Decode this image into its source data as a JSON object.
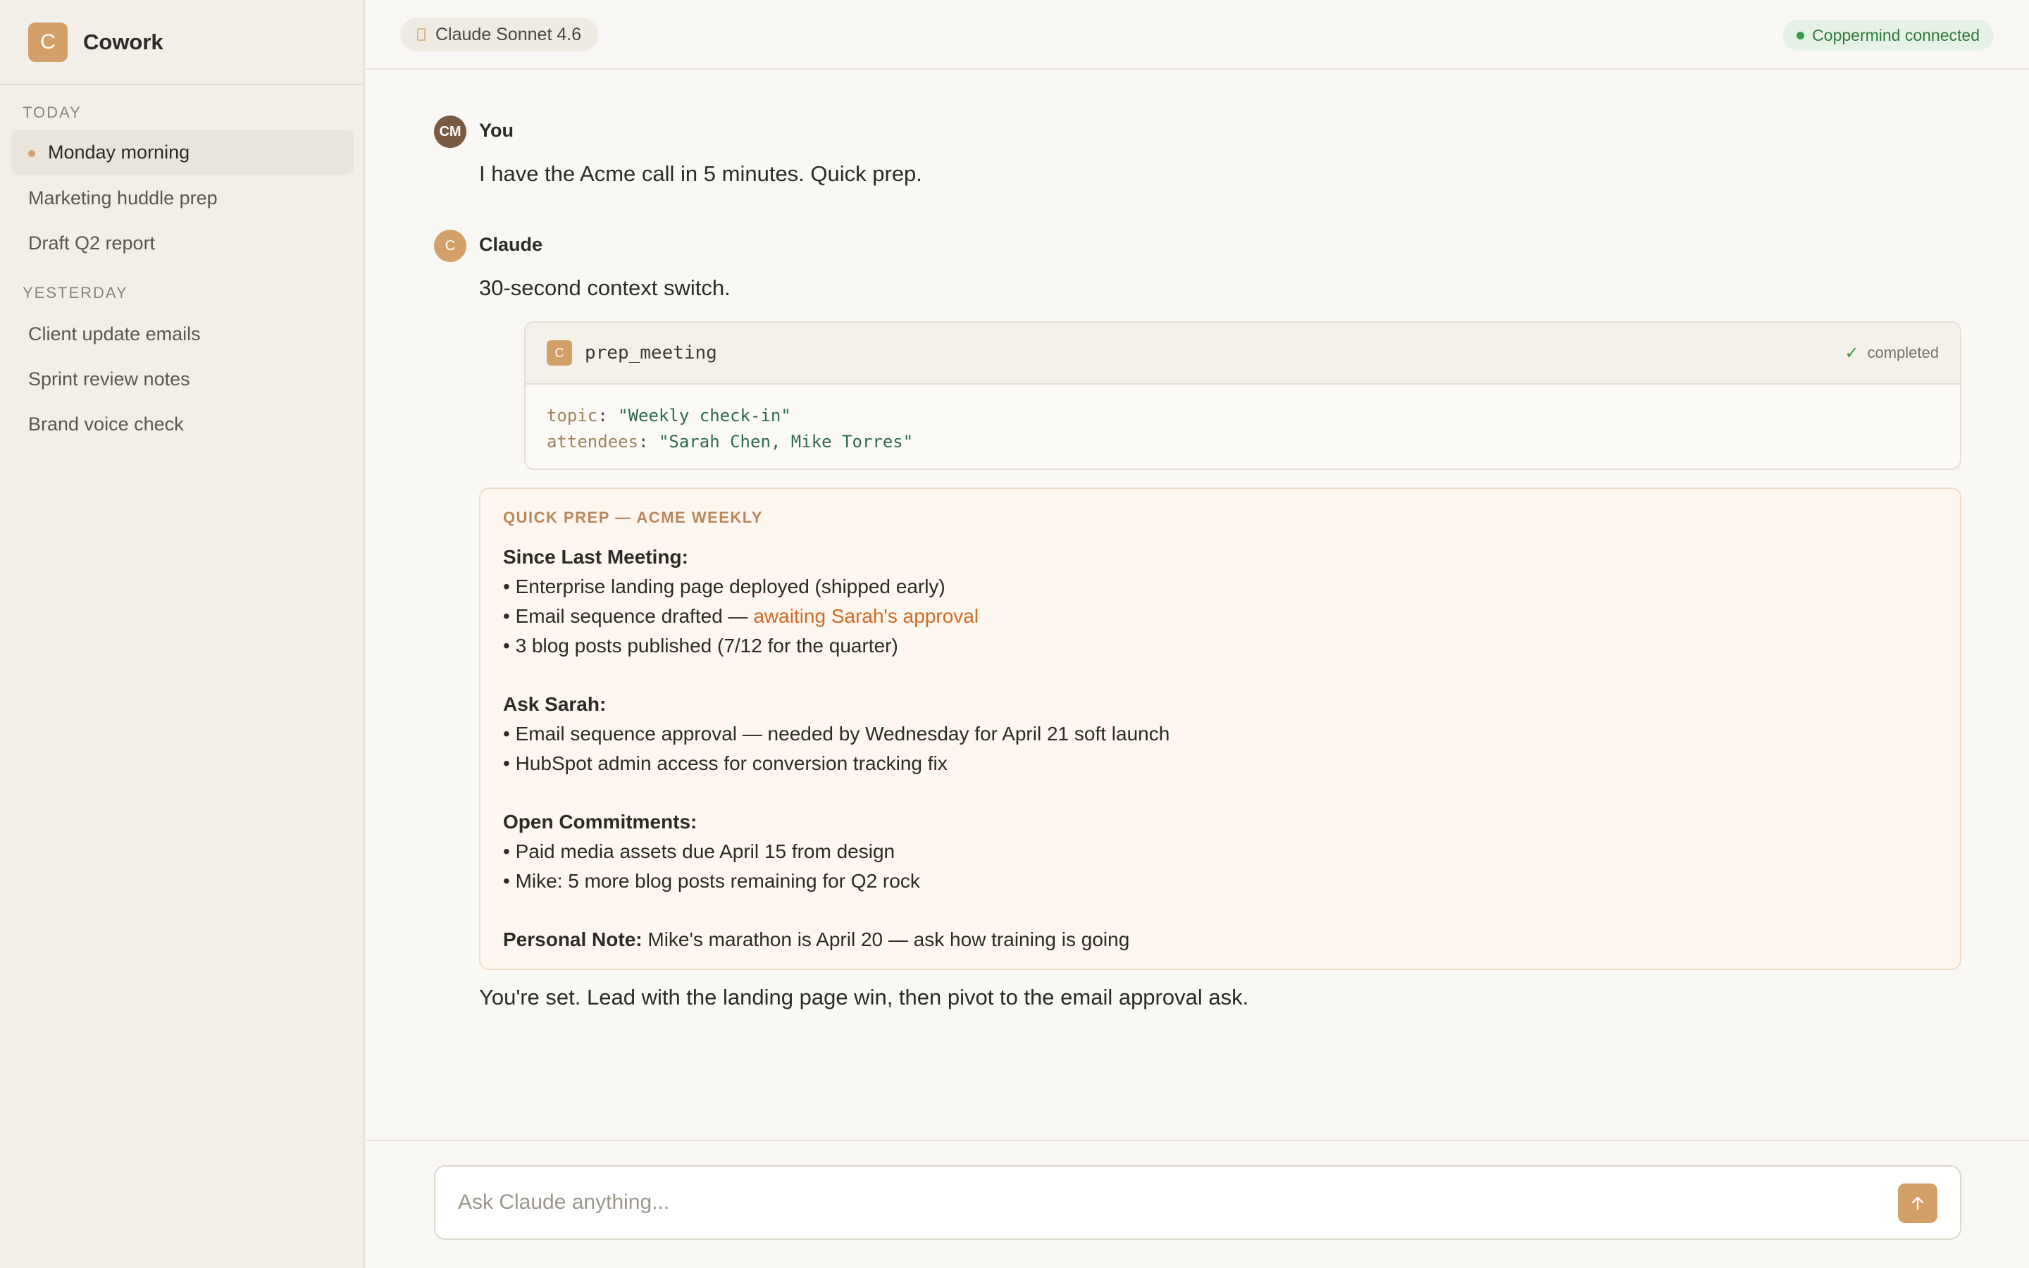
{
  "app": {
    "logo_letter": "C",
    "name": "Cowork"
  },
  "sidebar": {
    "today_label": "TODAY",
    "yesterday_label": "YESTERDAY",
    "today_items": [
      {
        "label": "Monday morning",
        "active": true
      },
      {
        "label": "Marketing huddle prep"
      },
      {
        "label": "Draft Q2 report"
      }
    ],
    "yesterday_items": [
      {
        "label": "Client update emails"
      },
      {
        "label": "Sprint review notes"
      },
      {
        "label": "Brand voice check"
      }
    ]
  },
  "topbar": {
    "model": "Claude Sonnet 4.6",
    "status": "Coppermind connected"
  },
  "conversation": {
    "user": {
      "initials": "CM",
      "name": "You",
      "text": "I have the Acme call in 5 minutes. Quick prep."
    },
    "assistant": {
      "initial": "C",
      "name": "Claude",
      "intro": "30-second context switch.",
      "tool": {
        "icon_letter": "C",
        "name": "prep_meeting",
        "status": "completed",
        "params": [
          {
            "key": "topic",
            "value": "\"Weekly check-in\""
          },
          {
            "key": "attendees",
            "value": "\"Sarah Chen, Mike Torres\""
          }
        ]
      },
      "prep": {
        "title": "QUICK PREP — ACME WEEKLY",
        "since_heading": "Since Last Meeting:",
        "since_1": "• Enterprise landing page deployed (shipped early)",
        "since_2_prefix": "• Email sequence drafted — ",
        "since_2_highlight": "awaiting Sarah's approval",
        "since_3": "• 3 blog posts published (7/12 for the quarter)",
        "ask_heading": "Ask Sarah:",
        "ask_1": "• Email sequence approval — needed by Wednesday for April 21 soft launch",
        "ask_2": "• HubSpot admin access for conversion tracking fix",
        "open_heading": "Open Commitments:",
        "open_1": "• Paid media assets due April 15 from design",
        "open_2": "• Mike: 5 more blog posts remaining for Q2 rock",
        "note_heading": "Personal Note:",
        "note_text": " Mike's marathon is April 20 — ask how training is going",
        "highlight_color": "#d06a24"
      },
      "closing": "You're set. Lead with the landing page win, then pivot to the email approval ask."
    }
  },
  "composer": {
    "placeholder": "Ask Claude anything...",
    "value": ""
  },
  "colors": {
    "accent": "#d4a06a",
    "status_green": "#3a9a48"
  },
  "icons": {
    "send": "arrow-up-icon",
    "check": "check-icon"
  }
}
